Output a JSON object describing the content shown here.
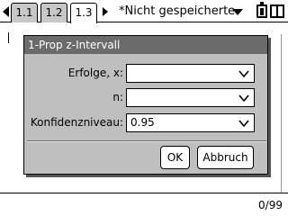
{
  "tabs": [
    {
      "label": "1.1",
      "active": false
    },
    {
      "label": "1.2",
      "active": false
    },
    {
      "label": "1.3",
      "active": true
    }
  ],
  "document_title": "*Nicht gespeicherte",
  "dialog": {
    "title": "1-Prop z-Intervall",
    "fields": [
      {
        "label": "Erfolge, x:",
        "value": ""
      },
      {
        "label": "n:",
        "value": ""
      },
      {
        "label": "Konfidenzniveau:",
        "value": "0.95"
      }
    ],
    "ok_label": "OK",
    "cancel_label": "Abbruch"
  },
  "status": {
    "counter": "0/99"
  }
}
